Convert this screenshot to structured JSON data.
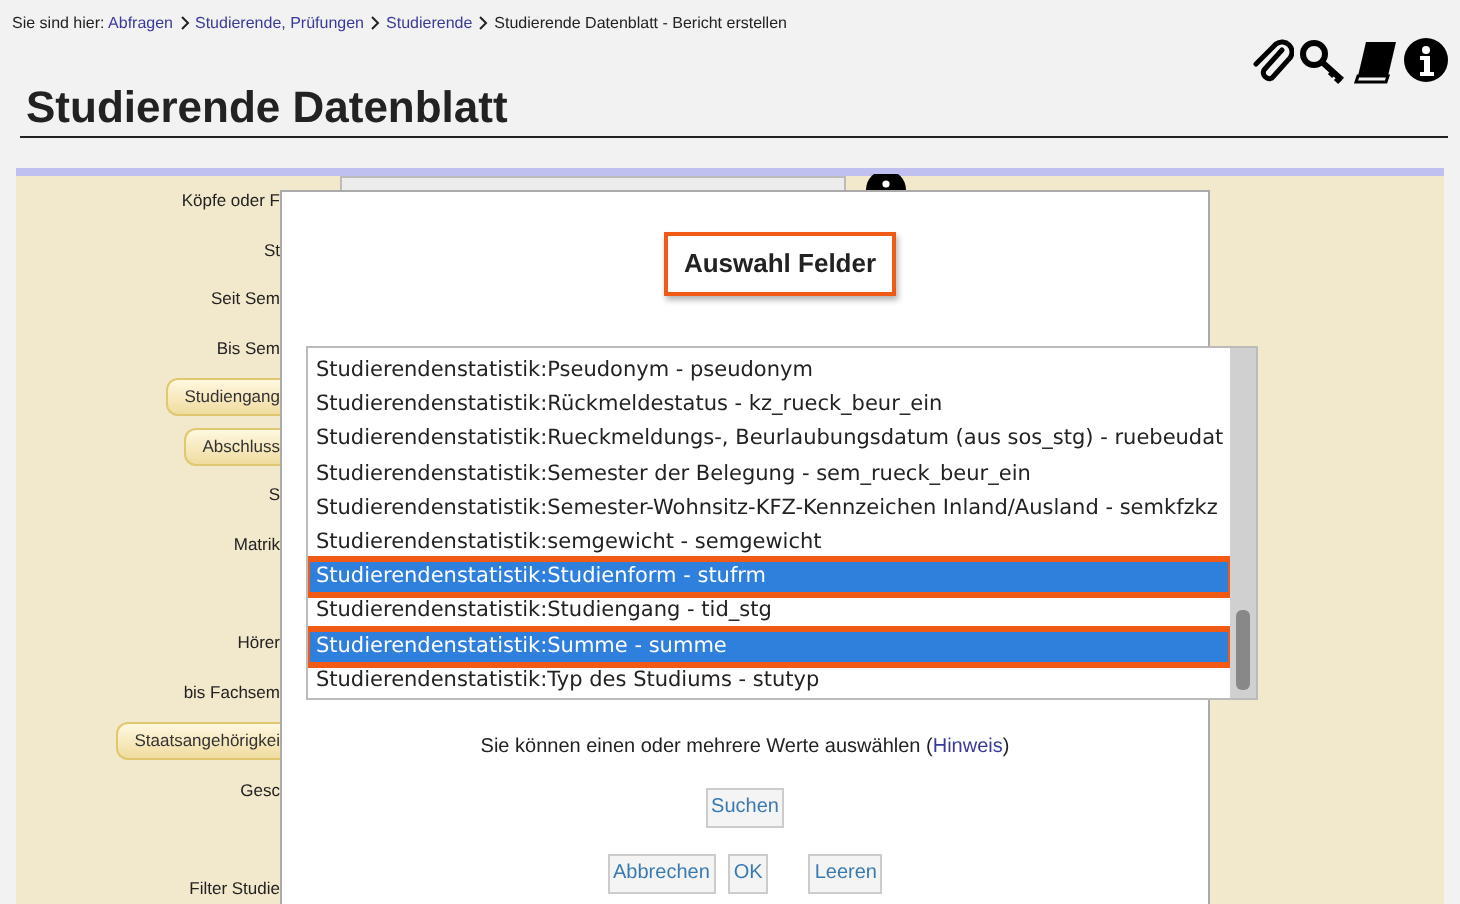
{
  "breadcrumb": {
    "prefix": "Sie sind hier:",
    "links": [
      "Abfragen",
      "Studierende, Prüfungen",
      "Studierende"
    ],
    "current": "Studierende Datenblatt - Bericht erstellen"
  },
  "title": "Studierende Datenblatt",
  "form_rows": [
    {
      "kind": "label",
      "text": "Köpfe oder F"
    },
    {
      "kind": "label",
      "text": "St"
    },
    {
      "kind": "label",
      "text": "Seit Sem"
    },
    {
      "kind": "label",
      "text": "Bis Sem"
    },
    {
      "kind": "button",
      "text": "Studiengang"
    },
    {
      "kind": "button",
      "text": "Abschluss"
    },
    {
      "kind": "label",
      "text": "S"
    },
    {
      "kind": "label",
      "text": "Matrik"
    },
    {
      "kind": "spacer"
    },
    {
      "kind": "label",
      "text": "Hörer"
    },
    {
      "kind": "label",
      "text": "bis Fachsem"
    },
    {
      "kind": "button",
      "text": "Staatsangehörigkei"
    },
    {
      "kind": "label",
      "text": "Gesc"
    },
    {
      "kind": "spacer"
    },
    {
      "kind": "label",
      "text": "Filter Studie"
    }
  ],
  "dialog": {
    "title": "Auswahl Felder",
    "options": [
      {
        "text": "Studierendenstatistik:Pseudonym - pseudonym",
        "selected": false
      },
      {
        "text": "Studierendenstatistik:Rückmeldestatus - kz_rueck_beur_ein",
        "selected": false
      },
      {
        "text": "Studierendenstatistik:Rueckmeldungs-, Beurlaubungsdatum (aus sos_stg) - ruebeudat",
        "selected": false
      },
      {
        "text": "Studierendenstatistik:Semester der Belegung - sem_rueck_beur_ein",
        "selected": false
      },
      {
        "text": "Studierendenstatistik:Semester-Wohnsitz-KFZ-Kennzeichen Inland/Ausland - semkfzkz",
        "selected": false
      },
      {
        "text": "Studierendenstatistik:semgewicht - semgewicht",
        "selected": false
      },
      {
        "text": "Studierendenstatistik:Studienform - stufrm",
        "selected": true
      },
      {
        "text": "Studierendenstatistik:Studiengang - tid_stg",
        "selected": false
      },
      {
        "text": "Studierendenstatistik:Summe - summe",
        "selected": true
      },
      {
        "text": "Studierendenstatistik:Typ des Studiums - stutyp",
        "selected": false
      }
    ],
    "hint_before": "Sie können einen oder mehrere Werte auswählen (",
    "hint_link": "Hinweis",
    "hint_after": ")",
    "search_button": "Suchen",
    "buttons": [
      "Abbrechen",
      "OK",
      "Leeren"
    ]
  }
}
